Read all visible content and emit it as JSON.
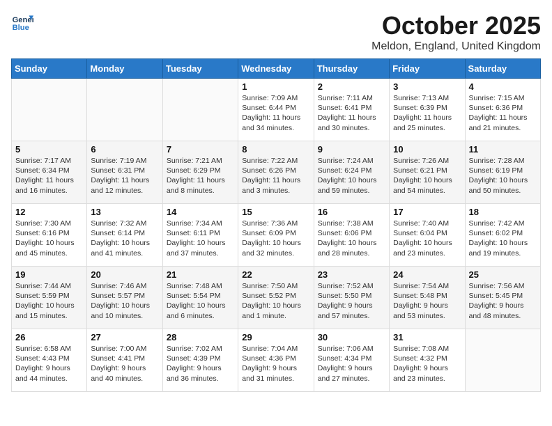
{
  "logo": {
    "line1": "General",
    "line2": "Blue"
  },
  "title": "October 2025",
  "subtitle": "Meldon, England, United Kingdom",
  "weekdays": [
    "Sunday",
    "Monday",
    "Tuesday",
    "Wednesday",
    "Thursday",
    "Friday",
    "Saturday"
  ],
  "weeks": [
    [
      {
        "day": "",
        "info": ""
      },
      {
        "day": "",
        "info": ""
      },
      {
        "day": "",
        "info": ""
      },
      {
        "day": "1",
        "info": "Sunrise: 7:09 AM\nSunset: 6:44 PM\nDaylight: 11 hours\nand 34 minutes."
      },
      {
        "day": "2",
        "info": "Sunrise: 7:11 AM\nSunset: 6:41 PM\nDaylight: 11 hours\nand 30 minutes."
      },
      {
        "day": "3",
        "info": "Sunrise: 7:13 AM\nSunset: 6:39 PM\nDaylight: 11 hours\nand 25 minutes."
      },
      {
        "day": "4",
        "info": "Sunrise: 7:15 AM\nSunset: 6:36 PM\nDaylight: 11 hours\nand 21 minutes."
      }
    ],
    [
      {
        "day": "5",
        "info": "Sunrise: 7:17 AM\nSunset: 6:34 PM\nDaylight: 11 hours\nand 16 minutes."
      },
      {
        "day": "6",
        "info": "Sunrise: 7:19 AM\nSunset: 6:31 PM\nDaylight: 11 hours\nand 12 minutes."
      },
      {
        "day": "7",
        "info": "Sunrise: 7:21 AM\nSunset: 6:29 PM\nDaylight: 11 hours\nand 8 minutes."
      },
      {
        "day": "8",
        "info": "Sunrise: 7:22 AM\nSunset: 6:26 PM\nDaylight: 11 hours\nand 3 minutes."
      },
      {
        "day": "9",
        "info": "Sunrise: 7:24 AM\nSunset: 6:24 PM\nDaylight: 10 hours\nand 59 minutes."
      },
      {
        "day": "10",
        "info": "Sunrise: 7:26 AM\nSunset: 6:21 PM\nDaylight: 10 hours\nand 54 minutes."
      },
      {
        "day": "11",
        "info": "Sunrise: 7:28 AM\nSunset: 6:19 PM\nDaylight: 10 hours\nand 50 minutes."
      }
    ],
    [
      {
        "day": "12",
        "info": "Sunrise: 7:30 AM\nSunset: 6:16 PM\nDaylight: 10 hours\nand 45 minutes."
      },
      {
        "day": "13",
        "info": "Sunrise: 7:32 AM\nSunset: 6:14 PM\nDaylight: 10 hours\nand 41 minutes."
      },
      {
        "day": "14",
        "info": "Sunrise: 7:34 AM\nSunset: 6:11 PM\nDaylight: 10 hours\nand 37 minutes."
      },
      {
        "day": "15",
        "info": "Sunrise: 7:36 AM\nSunset: 6:09 PM\nDaylight: 10 hours\nand 32 minutes."
      },
      {
        "day": "16",
        "info": "Sunrise: 7:38 AM\nSunset: 6:06 PM\nDaylight: 10 hours\nand 28 minutes."
      },
      {
        "day": "17",
        "info": "Sunrise: 7:40 AM\nSunset: 6:04 PM\nDaylight: 10 hours\nand 23 minutes."
      },
      {
        "day": "18",
        "info": "Sunrise: 7:42 AM\nSunset: 6:02 PM\nDaylight: 10 hours\nand 19 minutes."
      }
    ],
    [
      {
        "day": "19",
        "info": "Sunrise: 7:44 AM\nSunset: 5:59 PM\nDaylight: 10 hours\nand 15 minutes."
      },
      {
        "day": "20",
        "info": "Sunrise: 7:46 AM\nSunset: 5:57 PM\nDaylight: 10 hours\nand 10 minutes."
      },
      {
        "day": "21",
        "info": "Sunrise: 7:48 AM\nSunset: 5:54 PM\nDaylight: 10 hours\nand 6 minutes."
      },
      {
        "day": "22",
        "info": "Sunrise: 7:50 AM\nSunset: 5:52 PM\nDaylight: 10 hours\nand 1 minute."
      },
      {
        "day": "23",
        "info": "Sunrise: 7:52 AM\nSunset: 5:50 PM\nDaylight: 9 hours\nand 57 minutes."
      },
      {
        "day": "24",
        "info": "Sunrise: 7:54 AM\nSunset: 5:48 PM\nDaylight: 9 hours\nand 53 minutes."
      },
      {
        "day": "25",
        "info": "Sunrise: 7:56 AM\nSunset: 5:45 PM\nDaylight: 9 hours\nand 48 minutes."
      }
    ],
    [
      {
        "day": "26",
        "info": "Sunrise: 6:58 AM\nSunset: 4:43 PM\nDaylight: 9 hours\nand 44 minutes."
      },
      {
        "day": "27",
        "info": "Sunrise: 7:00 AM\nSunset: 4:41 PM\nDaylight: 9 hours\nand 40 minutes."
      },
      {
        "day": "28",
        "info": "Sunrise: 7:02 AM\nSunset: 4:39 PM\nDaylight: 9 hours\nand 36 minutes."
      },
      {
        "day": "29",
        "info": "Sunrise: 7:04 AM\nSunset: 4:36 PM\nDaylight: 9 hours\nand 31 minutes."
      },
      {
        "day": "30",
        "info": "Sunrise: 7:06 AM\nSunset: 4:34 PM\nDaylight: 9 hours\nand 27 minutes."
      },
      {
        "day": "31",
        "info": "Sunrise: 7:08 AM\nSunset: 4:32 PM\nDaylight: 9 hours\nand 23 minutes."
      },
      {
        "day": "",
        "info": ""
      }
    ]
  ]
}
